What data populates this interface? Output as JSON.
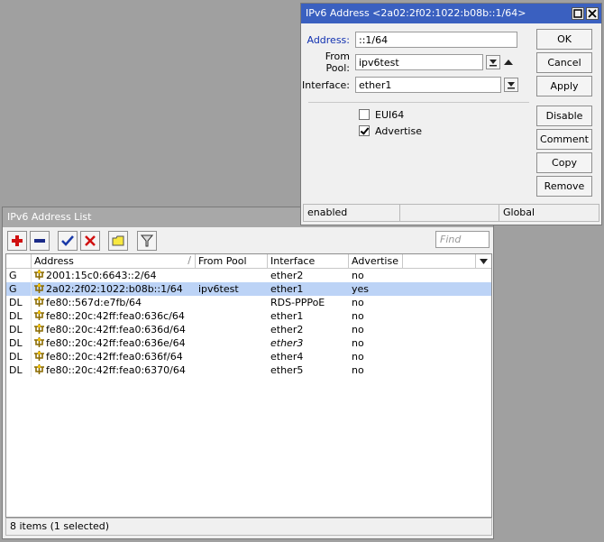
{
  "list_window": {
    "title": "IPv6 Address List",
    "toolbar": {
      "add": "+",
      "remove": "−",
      "enable": "✔",
      "disable": "✖",
      "comment_icon": "note-icon",
      "filter_icon": "filter-icon",
      "find_placeholder": "Find"
    },
    "columns": [
      "",
      "Address",
      "From Pool",
      "Interface",
      "Advertise"
    ],
    "rows": [
      {
        "flag": "G",
        "address": "2001:15c0:6643::2/64",
        "pool": "",
        "interface": "ether2",
        "advertise": "no",
        "italic": false
      },
      {
        "flag": "G",
        "address": "2a02:2f02:1022:b08b::1/64",
        "pool": "ipv6test",
        "interface": "ether1",
        "advertise": "yes",
        "italic": false
      },
      {
        "flag": "DL",
        "address": "fe80::567d:e7fb/64",
        "pool": "",
        "interface": "RDS-PPPoE",
        "advertise": "no",
        "italic": false
      },
      {
        "flag": "DL",
        "address": "fe80::20c:42ff:fea0:636c/64",
        "pool": "",
        "interface": "ether1",
        "advertise": "no",
        "italic": false
      },
      {
        "flag": "DL",
        "address": "fe80::20c:42ff:fea0:636d/64",
        "pool": "",
        "interface": "ether2",
        "advertise": "no",
        "italic": false
      },
      {
        "flag": "DL",
        "address": "fe80::20c:42ff:fea0:636e/64",
        "pool": "",
        "interface": "ether3",
        "advertise": "no",
        "italic": true
      },
      {
        "flag": "DL",
        "address": "fe80::20c:42ff:fea0:636f/64",
        "pool": "",
        "interface": "ether4",
        "advertise": "no",
        "italic": false
      },
      {
        "flag": "DL",
        "address": "fe80::20c:42ff:fea0:6370/64",
        "pool": "",
        "interface": "ether5",
        "advertise": "no",
        "italic": false
      }
    ],
    "selected_index": 1,
    "status": "8 items (1 selected)"
  },
  "dialog": {
    "title": "IPv6 Address <2a02:2f02:1022:b08b::1/64>",
    "address_label": "Address:",
    "address_value": "::1/64",
    "from_pool_label": "From Pool:",
    "from_pool_value": "ipv6test",
    "interface_label": "Interface:",
    "interface_value": "ether1",
    "eui64_label": "EUI64",
    "eui64_checked": false,
    "advertise_label": "Advertise",
    "advertise_checked": true,
    "buttons": {
      "ok": "OK",
      "cancel": "Cancel",
      "apply": "Apply",
      "disable": "Disable",
      "comment": "Comment",
      "copy": "Copy",
      "remove": "Remove"
    },
    "status": {
      "state": "enabled",
      "middle": "",
      "scope": "Global"
    }
  },
  "colors": {
    "active_title": "#3a60c0",
    "inactive_title": "#a8a8a8",
    "selected_row": "#bcd3f6",
    "desktop": "#a0a0a0"
  }
}
